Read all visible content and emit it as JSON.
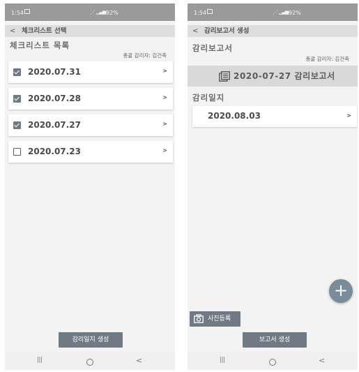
{
  "left_screen": {
    "status": {
      "time": "1:54",
      "battery": "92%"
    },
    "app_bar": {
      "title": "체크리스트 선택"
    },
    "section_title": "체크리스트 목록",
    "supervisor": "총괄 감리자: 김건축",
    "items": [
      {
        "date": "2020.07.31",
        "checked": true
      },
      {
        "date": "2020.07.28",
        "checked": true
      },
      {
        "date": "2020.07.27",
        "checked": true
      },
      {
        "date": "2020.07.23",
        "checked": false
      }
    ],
    "create_button_label": "감리일지 생성"
  },
  "right_screen": {
    "status": {
      "time": "1:54",
      "battery": "92%"
    },
    "app_bar": {
      "title": "감리보고서 생성"
    },
    "section_title": "감리보고서",
    "supervisor": "총괄 감리자: 김건축",
    "report_banner": "2020-07-27 감리보고서",
    "diary_section_title": "감리일지",
    "diary_items": [
      {
        "date": "2020.08.03"
      }
    ],
    "fab_label": "+",
    "photo_button_label": "사진등록",
    "create_report_button_label": "보고서 생성"
  },
  "chevron_glyph": ">",
  "nav": {
    "recent": "|||",
    "back": "<"
  },
  "icons": {
    "checkbox_checked": "checkbox-checked-icon",
    "checkbox_unchecked": "checkbox-empty-icon",
    "report": "document-icon",
    "camera": "camera-icon"
  },
  "colors": {
    "status_bar": "#9a9a9a",
    "app_bar": "#dedede",
    "button": "#6f7a84",
    "fab": "#7a8c9a",
    "background": "#f3f3f3"
  }
}
